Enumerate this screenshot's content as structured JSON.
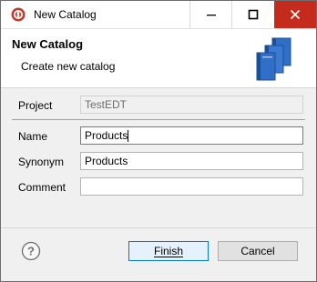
{
  "window": {
    "title": "New Catalog",
    "minimize_label": "Minimize",
    "maximize_label": "Maximize",
    "close_label": "Close"
  },
  "header": {
    "title": "New Catalog",
    "description": "Create new catalog",
    "icon": "catalog-books-icon"
  },
  "form": {
    "project_label": "Project",
    "project_value": "TestEDT",
    "name_label": "Name",
    "name_value": "Products",
    "synonym_label": "Synonym",
    "synonym_value": "Products",
    "comment_label": "Comment",
    "comment_value": ""
  },
  "footer": {
    "help_icon": "help-icon",
    "finish_label": "Finish",
    "cancel_label": "Cancel"
  },
  "colors": {
    "close_button": "#c42b1c",
    "book_blue": "#2f6fc7",
    "default_button_border": "#0078d7"
  }
}
